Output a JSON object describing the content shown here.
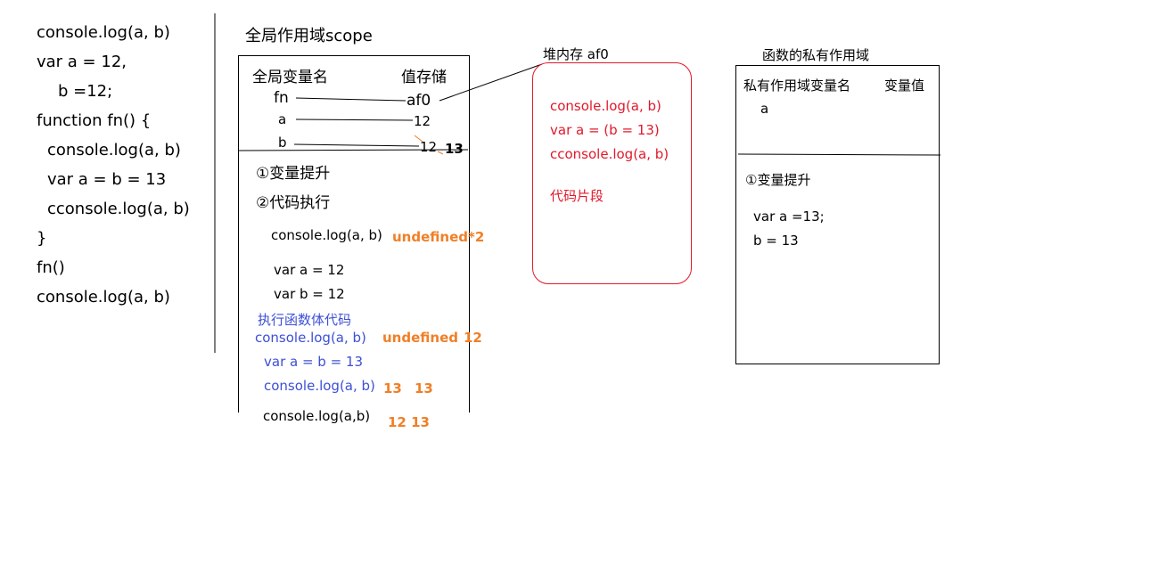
{
  "left_code": [
    "console.log(a, b)",
    "var a = 12,",
    "b =12;",
    "function fn() {",
    "console.log(a, b)",
    "var a = b = 13",
    "cconsole.log(a, b)",
    "}",
    "fn()",
    "console.log(a, b)"
  ],
  "global_scope": {
    "title": "全局作用域scope",
    "col_name": "全局变量名",
    "col_value": "值存储",
    "vars": [
      {
        "name": "fn",
        "value": "af0"
      },
      {
        "name": "a",
        "value": "12"
      },
      {
        "name": "b",
        "value": "12",
        "new_value": "13"
      }
    ],
    "step1": "①变量提升",
    "step2": "②代码执行",
    "exec_log1": "console.log(a, b)",
    "exec_log1_result": "undefined*2",
    "exec_var_a": "var a = 12",
    "exec_var_b": "var b = 12",
    "exec_fn_body": "执行函数体代码",
    "exec_fn_log1": "console.log(a, b)",
    "exec_fn_log1_result": "undefined",
    "exec_fn_log1_result2": "12",
    "exec_fn_assign": "var a = b = 13",
    "exec_fn_log2": "console.log(a, b)",
    "exec_fn_log2_result1": "13",
    "exec_fn_log2_result2": "13",
    "exec_final_log": "console.log(a,b)",
    "exec_final_result": "12 13"
  },
  "heap": {
    "title": "堆内存 af0",
    "lines": [
      "console.log(a, b)",
      "var a = (b = 13)",
      "cconsole.log(a, b)"
    ],
    "footer": "代码片段"
  },
  "private_scope": {
    "title": "函数的私有作用域",
    "col_name": "私有作用域变量名",
    "col_value": "变量值",
    "var_a": "a",
    "step1": "①变量提升",
    "line1": "var a =13;",
    "line2": "b = 13"
  },
  "colors": {
    "red": "#e0192b",
    "blue": "#3d4fd6",
    "orange": "#f07f27"
  }
}
